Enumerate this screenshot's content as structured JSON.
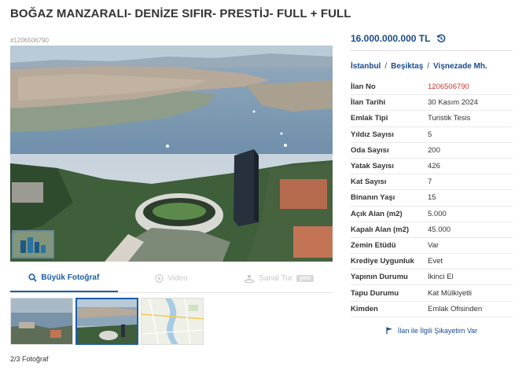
{
  "header": {
    "title": "BOĞAZ MANZARALI- DENİZE SIFIR- PRESTİJ- FULL + FULL"
  },
  "gallery": {
    "listing_code": "#1206506790",
    "tabs": [
      {
        "label": "Büyük Fotoğraf",
        "icon": "magnifier-icon"
      },
      {
        "label": "Video",
        "icon": "play-icon"
      },
      {
        "label": "Sanal Tur",
        "icon": "virtual-tour-icon",
        "badge": "yeni"
      }
    ],
    "photo_count": "2/3 Fotoğraf"
  },
  "sidebar": {
    "price": "16.000.000.000 TL",
    "location": [
      "İstanbul",
      "Beşiktaş",
      "Vişnezade Mh."
    ],
    "properties": [
      {
        "label": "İlan No",
        "value": "1206506790"
      },
      {
        "label": "İlan Tarihi",
        "value": "30 Kasım 2024"
      },
      {
        "label": "Emlak Tipi",
        "value": "Turistik Tesis"
      },
      {
        "label": "Yıldız Sayısı",
        "value": "5"
      },
      {
        "label": "Oda Sayısı",
        "value": "200"
      },
      {
        "label": "Yatak Sayısı",
        "value": "426"
      },
      {
        "label": "Kat Sayısı",
        "value": "7"
      },
      {
        "label": "Binanın Yaşı",
        "value": "15"
      },
      {
        "label": "Açık Alan (m2)",
        "value": "5.000"
      },
      {
        "label": "Kapalı Alan (m2)",
        "value": "45.000"
      },
      {
        "label": "Zemin Etüdü",
        "value": "Var"
      },
      {
        "label": "Krediye Uygunluk",
        "value": "Evet"
      },
      {
        "label": "Yapının Durumu",
        "value": "İkinci El"
      },
      {
        "label": "Tapu Durumu",
        "value": "Kat Mülkiyetli"
      },
      {
        "label": "Kimden",
        "value": "Emlak Ofisinden"
      }
    ],
    "complaint_link": "İlan ile İlgili Şikayetim Var"
  },
  "colors": {
    "brand_blue": "#1a4b8c",
    "listing_no_red": "#d0342c"
  }
}
